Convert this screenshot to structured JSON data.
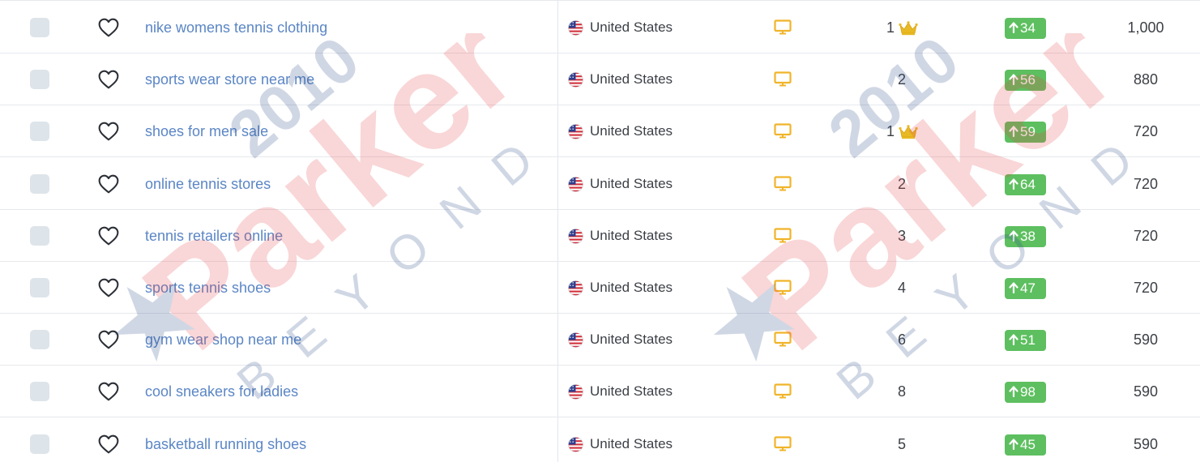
{
  "rows": [
    {
      "keyword": "nike womens tennis clothing",
      "country": "United States",
      "position": "1",
      "top": true,
      "change": "34",
      "volume": "1,000"
    },
    {
      "keyword": "sports wear store near me",
      "country": "United States",
      "position": "2",
      "top": false,
      "change": "56",
      "volume": "880"
    },
    {
      "keyword": "shoes for men sale",
      "country": "United States",
      "position": "1",
      "top": true,
      "change": "59",
      "volume": "720"
    },
    {
      "keyword": "online tennis stores",
      "country": "United States",
      "position": "2",
      "top": false,
      "change": "64",
      "volume": "720"
    },
    {
      "keyword": "tennis retailers online",
      "country": "United States",
      "position": "3",
      "top": false,
      "change": "38",
      "volume": "720"
    },
    {
      "keyword": "sports tennis shoes",
      "country": "United States",
      "position": "4",
      "top": false,
      "change": "47",
      "volume": "720"
    },
    {
      "keyword": "gym wear shop near me",
      "country": "United States",
      "position": "6",
      "top": false,
      "change": "51",
      "volume": "590"
    },
    {
      "keyword": "cool sneakers for ladies",
      "country": "United States",
      "position": "8",
      "top": false,
      "change": "98",
      "volume": "590"
    },
    {
      "keyword": "basketball running shoes",
      "country": "United States",
      "position": "5",
      "top": false,
      "change": "45",
      "volume": "590"
    }
  ],
  "icons": {
    "select": "checkbox",
    "favorite": "heart-icon",
    "country": "us-flag-icon",
    "device": "desktop-icon",
    "top_rank": "crown-icon",
    "change": "arrow-up-icon"
  },
  "watermark": {
    "brand": "Parker",
    "year": "2010",
    "tagline": "BEYOND SEO"
  },
  "colors": {
    "keyword_link": "#5b86c5",
    "badge_green": "#5dbf5f",
    "device_icon": "#f0b429",
    "crown": "#e8b923",
    "checkbox": "#dde4ea",
    "watermark_red": "#e8474c",
    "watermark_blue": "#2c4c8a"
  }
}
